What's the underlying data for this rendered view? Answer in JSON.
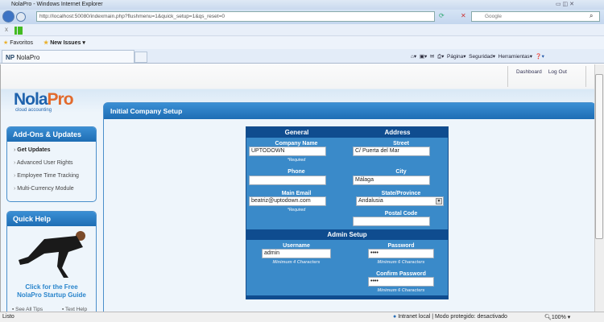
{
  "browser": {
    "title": "NolaPro - Windows Internet Explorer",
    "url": "http://localhost:50080/indexmain.php?flushmenu=1&quick_setup=1&qs_reset=0",
    "search_placeholder": "Google",
    "favorites_label": "Favoritos",
    "new_issues_label": "New Issues",
    "tab_label": "NolaPro",
    "menu": [
      "Página",
      "Seguridad",
      "Herramientas"
    ],
    "status_left": "Listo",
    "status_zone": "Intranet local | Modo protegido: desactivado",
    "zoom": "100%"
  },
  "header": {
    "logo": "NolaPro",
    "logo_tagline": "cloud accounting",
    "nav": [
      "Dashboard",
      "Log Out"
    ]
  },
  "sidebar": {
    "addons_title": "Add-Ons & Updates",
    "addons_items": [
      "Get Updates",
      "Advanced User Rights",
      "Employee Time Tracking",
      "Multi-Currency Module"
    ],
    "quickhelp_title": "Quick Help",
    "guide_text_1": "Click for the Free",
    "guide_text_2": "NolaPro Startup Guide",
    "links": [
      "See All Tips",
      "Text Help"
    ]
  },
  "main": {
    "title": "Initial Company Setup",
    "general_header": "General",
    "address_header": "Address",
    "company_name_label": "Company Name",
    "company_name": "UPTODOWN",
    "required": "*Required",
    "phone_label": "Phone",
    "phone": "",
    "email_label": "Main Email",
    "email": "beatriz@uptodown.com",
    "street_label": "Street",
    "street": "C/ Puerta del Mar",
    "city_label": "City",
    "city": "Málaga",
    "state_label": "State/Province",
    "state": "Andalusia",
    "postal_label": "Postal Code",
    "postal": "",
    "admin_header": "Admin Setup",
    "username_label": "Username",
    "username": "admin",
    "username_hint": "Minimum 4 Characters",
    "password_label": "Password",
    "password": "••••",
    "password_hint": "Minimum 6 Characters",
    "confirm_label": "Confirm Password",
    "confirm": "••••",
    "confirm_hint": "Minimum 6 Characters"
  }
}
